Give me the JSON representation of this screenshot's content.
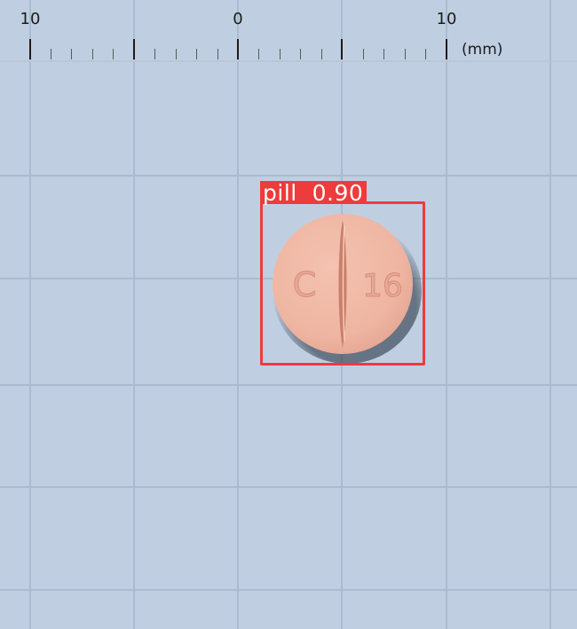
{
  "ruler": {
    "labels": [
      "10",
      "0",
      "10"
    ],
    "unit": "(mm)"
  },
  "detection": {
    "class_label": "pill",
    "confidence": "0.90",
    "box_color": "#ee3b3b"
  },
  "pill": {
    "imprint_left": "C",
    "imprint_right": "16",
    "color": "#eeb5a1"
  },
  "background_color": "#bfcfe1"
}
